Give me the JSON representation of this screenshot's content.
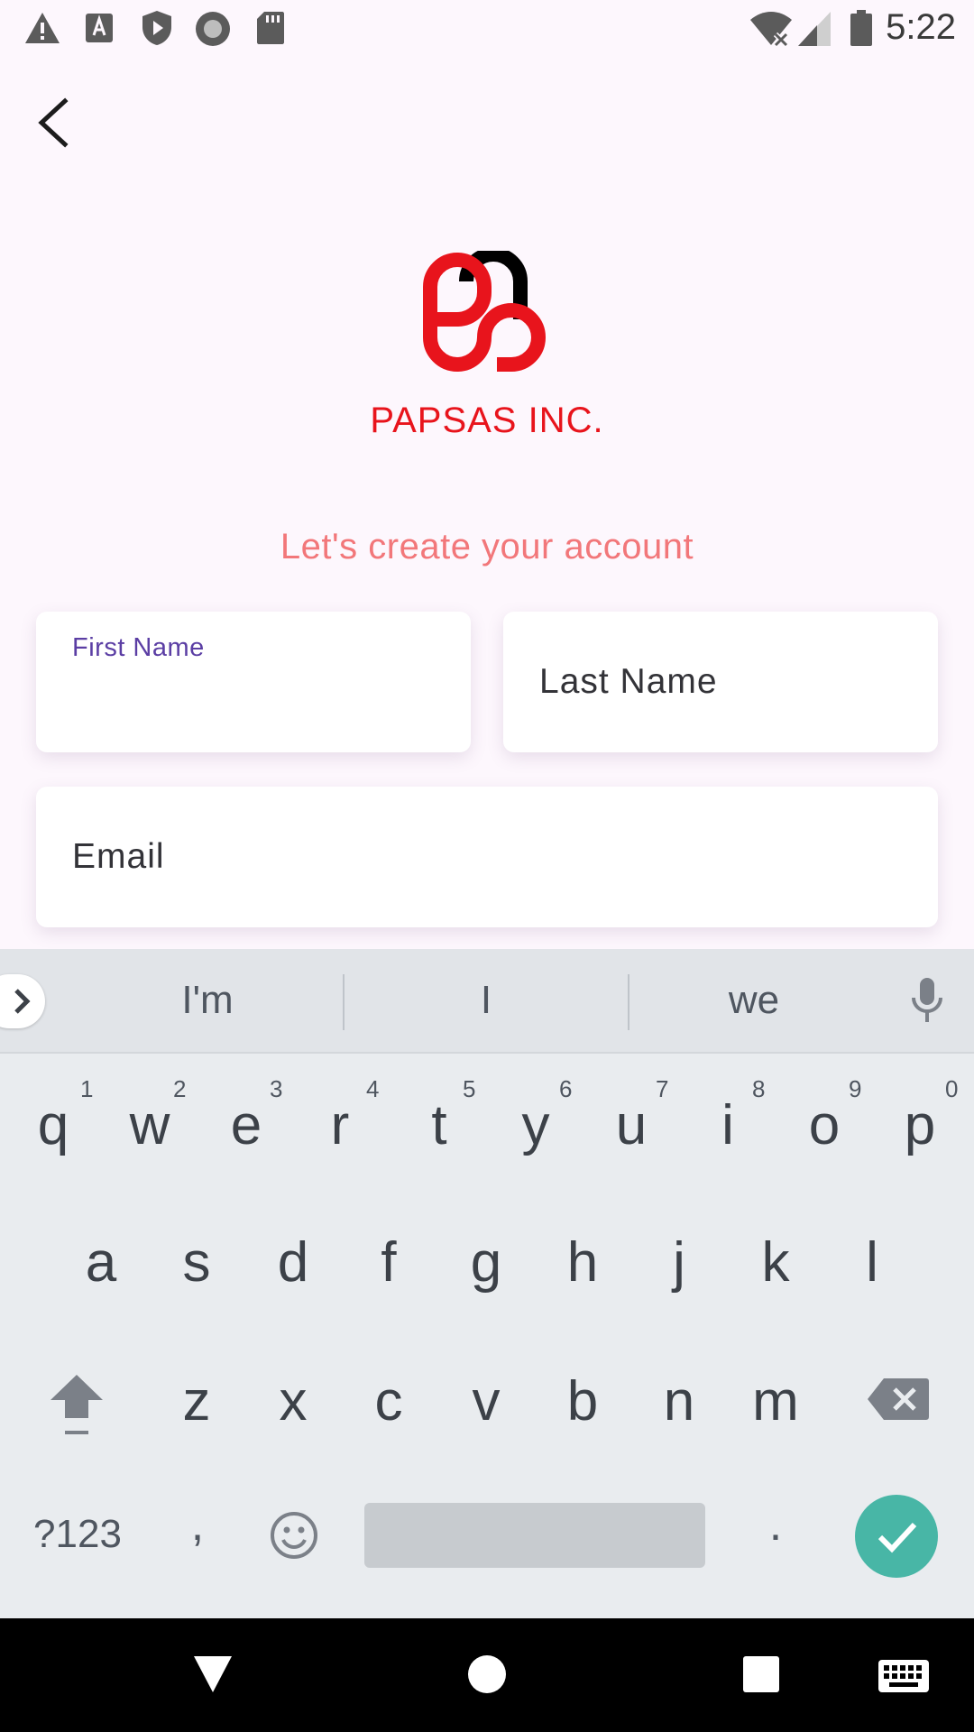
{
  "status_bar": {
    "time": "5:22",
    "left_icons": [
      "warning-icon",
      "font-a-icon",
      "shield-play-icon",
      "record-icon",
      "sd-card-icon"
    ],
    "right_icons": [
      "wifi-off-icon",
      "cell-signal-icon",
      "battery-icon"
    ]
  },
  "header": {
    "back_icon": "chevron-left-icon"
  },
  "brand": {
    "name": "PAPSAS INC.",
    "tagline": "Let's create your account",
    "colors": {
      "red": "#e8141c",
      "black": "#000000",
      "tagline": "#f2777a"
    }
  },
  "form": {
    "first_name": {
      "label": "First Name",
      "value": ""
    },
    "last_name": {
      "placeholder": "Last Name"
    },
    "email": {
      "placeholder": "Email"
    },
    "accent_color": "#5b3ea4"
  },
  "keyboard": {
    "suggestions": [
      "I'm",
      "I",
      "we"
    ],
    "row1": [
      {
        "key": "q",
        "hint": "1"
      },
      {
        "key": "w",
        "hint": "2"
      },
      {
        "key": "e",
        "hint": "3"
      },
      {
        "key": "r",
        "hint": "4"
      },
      {
        "key": "t",
        "hint": "5"
      },
      {
        "key": "y",
        "hint": "6"
      },
      {
        "key": "u",
        "hint": "7"
      },
      {
        "key": "i",
        "hint": "8"
      },
      {
        "key": "o",
        "hint": "9"
      },
      {
        "key": "p",
        "hint": "0"
      }
    ],
    "row2": [
      "a",
      "s",
      "d",
      "f",
      "g",
      "h",
      "j",
      "k",
      "l"
    ],
    "row3": [
      "z",
      "x",
      "c",
      "v",
      "b",
      "n",
      "m"
    ],
    "symbols_label": "?123",
    "comma": ",",
    "period": ".",
    "enter_color": "#48b6a6"
  },
  "nav_bar": {
    "icons": [
      "back-triangle-icon",
      "home-circle-icon",
      "recents-square-icon",
      "keyboard-switch-icon"
    ]
  }
}
